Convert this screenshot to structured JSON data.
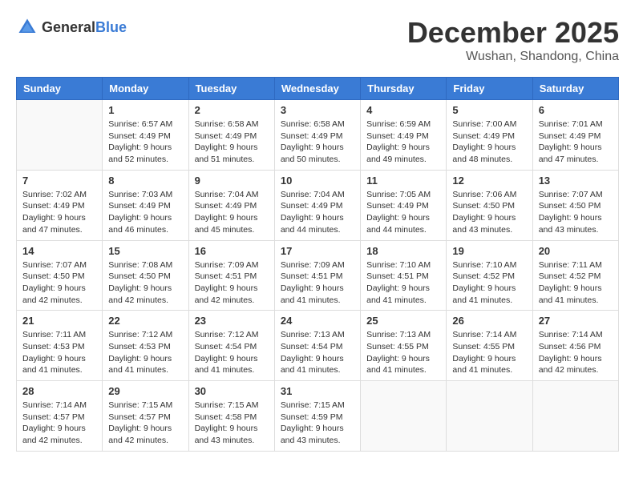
{
  "logo": {
    "general": "General",
    "blue": "Blue"
  },
  "header": {
    "month": "December 2025",
    "location": "Wushan, Shandong, China"
  },
  "weekdays": [
    "Sunday",
    "Monday",
    "Tuesday",
    "Wednesday",
    "Thursday",
    "Friday",
    "Saturday"
  ],
  "weeks": [
    [
      {
        "day": "",
        "sunrise": "",
        "sunset": "",
        "daylight": ""
      },
      {
        "day": "1",
        "sunrise": "Sunrise: 6:57 AM",
        "sunset": "Sunset: 4:49 PM",
        "daylight": "Daylight: 9 hours and 52 minutes."
      },
      {
        "day": "2",
        "sunrise": "Sunrise: 6:58 AM",
        "sunset": "Sunset: 4:49 PM",
        "daylight": "Daylight: 9 hours and 51 minutes."
      },
      {
        "day": "3",
        "sunrise": "Sunrise: 6:58 AM",
        "sunset": "Sunset: 4:49 PM",
        "daylight": "Daylight: 9 hours and 50 minutes."
      },
      {
        "day": "4",
        "sunrise": "Sunrise: 6:59 AM",
        "sunset": "Sunset: 4:49 PM",
        "daylight": "Daylight: 9 hours and 49 minutes."
      },
      {
        "day": "5",
        "sunrise": "Sunrise: 7:00 AM",
        "sunset": "Sunset: 4:49 PM",
        "daylight": "Daylight: 9 hours and 48 minutes."
      },
      {
        "day": "6",
        "sunrise": "Sunrise: 7:01 AM",
        "sunset": "Sunset: 4:49 PM",
        "daylight": "Daylight: 9 hours and 47 minutes."
      }
    ],
    [
      {
        "day": "7",
        "sunrise": "Sunrise: 7:02 AM",
        "sunset": "Sunset: 4:49 PM",
        "daylight": "Daylight: 9 hours and 47 minutes."
      },
      {
        "day": "8",
        "sunrise": "Sunrise: 7:03 AM",
        "sunset": "Sunset: 4:49 PM",
        "daylight": "Daylight: 9 hours and 46 minutes."
      },
      {
        "day": "9",
        "sunrise": "Sunrise: 7:04 AM",
        "sunset": "Sunset: 4:49 PM",
        "daylight": "Daylight: 9 hours and 45 minutes."
      },
      {
        "day": "10",
        "sunrise": "Sunrise: 7:04 AM",
        "sunset": "Sunset: 4:49 PM",
        "daylight": "Daylight: 9 hours and 44 minutes."
      },
      {
        "day": "11",
        "sunrise": "Sunrise: 7:05 AM",
        "sunset": "Sunset: 4:49 PM",
        "daylight": "Daylight: 9 hours and 44 minutes."
      },
      {
        "day": "12",
        "sunrise": "Sunrise: 7:06 AM",
        "sunset": "Sunset: 4:50 PM",
        "daylight": "Daylight: 9 hours and 43 minutes."
      },
      {
        "day": "13",
        "sunrise": "Sunrise: 7:07 AM",
        "sunset": "Sunset: 4:50 PM",
        "daylight": "Daylight: 9 hours and 43 minutes."
      }
    ],
    [
      {
        "day": "14",
        "sunrise": "Sunrise: 7:07 AM",
        "sunset": "Sunset: 4:50 PM",
        "daylight": "Daylight: 9 hours and 42 minutes."
      },
      {
        "day": "15",
        "sunrise": "Sunrise: 7:08 AM",
        "sunset": "Sunset: 4:50 PM",
        "daylight": "Daylight: 9 hours and 42 minutes."
      },
      {
        "day": "16",
        "sunrise": "Sunrise: 7:09 AM",
        "sunset": "Sunset: 4:51 PM",
        "daylight": "Daylight: 9 hours and 42 minutes."
      },
      {
        "day": "17",
        "sunrise": "Sunrise: 7:09 AM",
        "sunset": "Sunset: 4:51 PM",
        "daylight": "Daylight: 9 hours and 41 minutes."
      },
      {
        "day": "18",
        "sunrise": "Sunrise: 7:10 AM",
        "sunset": "Sunset: 4:51 PM",
        "daylight": "Daylight: 9 hours and 41 minutes."
      },
      {
        "day": "19",
        "sunrise": "Sunrise: 7:10 AM",
        "sunset": "Sunset: 4:52 PM",
        "daylight": "Daylight: 9 hours and 41 minutes."
      },
      {
        "day": "20",
        "sunrise": "Sunrise: 7:11 AM",
        "sunset": "Sunset: 4:52 PM",
        "daylight": "Daylight: 9 hours and 41 minutes."
      }
    ],
    [
      {
        "day": "21",
        "sunrise": "Sunrise: 7:11 AM",
        "sunset": "Sunset: 4:53 PM",
        "daylight": "Daylight: 9 hours and 41 minutes."
      },
      {
        "day": "22",
        "sunrise": "Sunrise: 7:12 AM",
        "sunset": "Sunset: 4:53 PM",
        "daylight": "Daylight: 9 hours and 41 minutes."
      },
      {
        "day": "23",
        "sunrise": "Sunrise: 7:12 AM",
        "sunset": "Sunset: 4:54 PM",
        "daylight": "Daylight: 9 hours and 41 minutes."
      },
      {
        "day": "24",
        "sunrise": "Sunrise: 7:13 AM",
        "sunset": "Sunset: 4:54 PM",
        "daylight": "Daylight: 9 hours and 41 minutes."
      },
      {
        "day": "25",
        "sunrise": "Sunrise: 7:13 AM",
        "sunset": "Sunset: 4:55 PM",
        "daylight": "Daylight: 9 hours and 41 minutes."
      },
      {
        "day": "26",
        "sunrise": "Sunrise: 7:14 AM",
        "sunset": "Sunset: 4:55 PM",
        "daylight": "Daylight: 9 hours and 41 minutes."
      },
      {
        "day": "27",
        "sunrise": "Sunrise: 7:14 AM",
        "sunset": "Sunset: 4:56 PM",
        "daylight": "Daylight: 9 hours and 42 minutes."
      }
    ],
    [
      {
        "day": "28",
        "sunrise": "Sunrise: 7:14 AM",
        "sunset": "Sunset: 4:57 PM",
        "daylight": "Daylight: 9 hours and 42 minutes."
      },
      {
        "day": "29",
        "sunrise": "Sunrise: 7:15 AM",
        "sunset": "Sunset: 4:57 PM",
        "daylight": "Daylight: 9 hours and 42 minutes."
      },
      {
        "day": "30",
        "sunrise": "Sunrise: 7:15 AM",
        "sunset": "Sunset: 4:58 PM",
        "daylight": "Daylight: 9 hours and 43 minutes."
      },
      {
        "day": "31",
        "sunrise": "Sunrise: 7:15 AM",
        "sunset": "Sunset: 4:59 PM",
        "daylight": "Daylight: 9 hours and 43 minutes."
      },
      {
        "day": "",
        "sunrise": "",
        "sunset": "",
        "daylight": ""
      },
      {
        "day": "",
        "sunrise": "",
        "sunset": "",
        "daylight": ""
      },
      {
        "day": "",
        "sunrise": "",
        "sunset": "",
        "daylight": ""
      }
    ]
  ]
}
